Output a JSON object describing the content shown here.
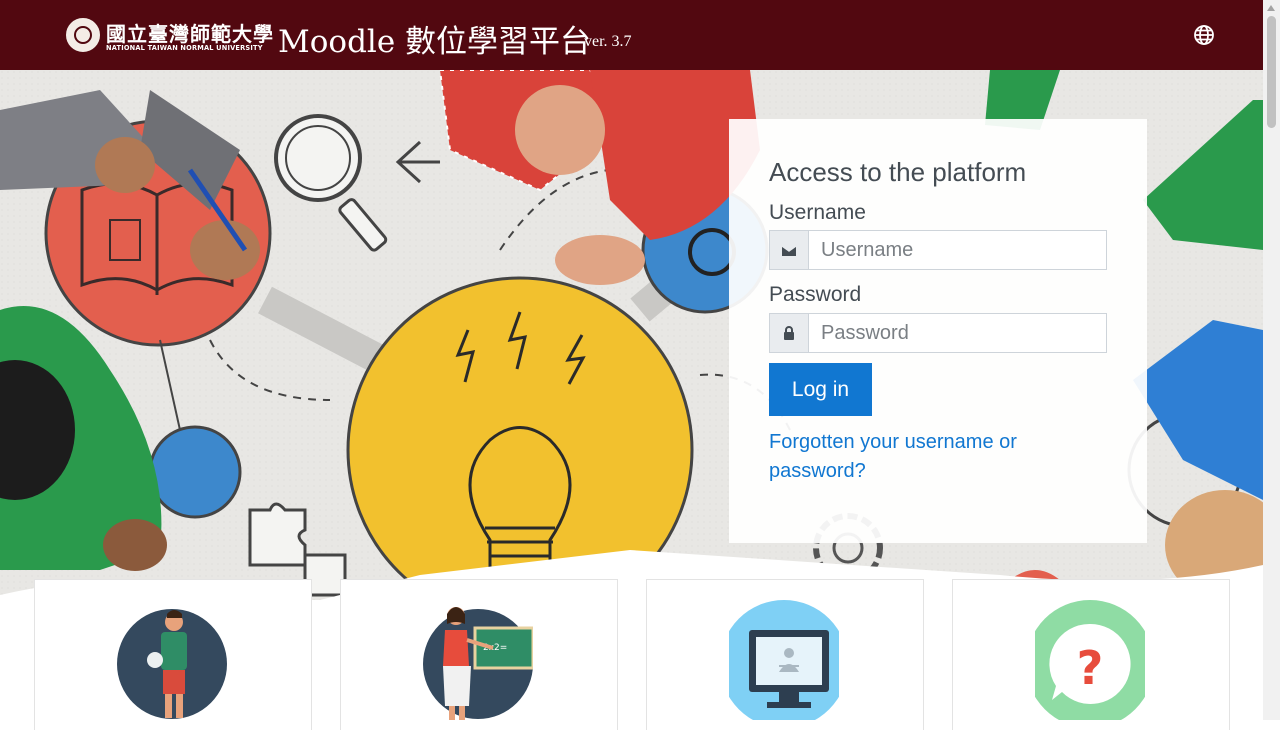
{
  "header": {
    "university_name_zh": "國立臺灣師範大學",
    "university_name_en": "NATIONAL TAIWAN NORMAL UNIVERSITY",
    "site_title": "Moodle 數位學習平台",
    "version": "ver. 3.7",
    "language_icon": "globe-icon"
  },
  "login": {
    "title": "Access to the platform",
    "username_label": "Username",
    "username_placeholder": "Username",
    "username_icon": "user-icon",
    "password_label": "Password",
    "password_placeholder": "Password",
    "password_icon": "lock-icon",
    "login_button": "Log in",
    "forgot_link": "Forgotten your username or password?"
  },
  "features": [
    {
      "icon": "student-icon",
      "color": "#34495e"
    },
    {
      "icon": "teacher-icon",
      "color": "#34495e"
    },
    {
      "icon": "monitor-icon",
      "color": "#7fd0f5"
    },
    {
      "icon": "help-question-icon",
      "color": "#8fdca4"
    }
  ],
  "colors": {
    "header_bg": "#520810",
    "accent": "#1177d1"
  }
}
